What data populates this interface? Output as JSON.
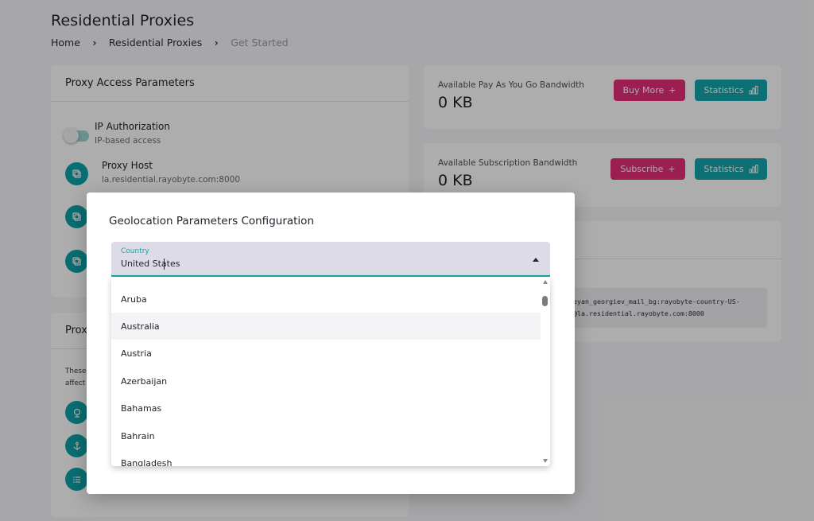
{
  "page": {
    "title": "Residential Proxies",
    "breadcrumb": [
      "Home",
      "Residential Proxies",
      "Get Started"
    ]
  },
  "access_card": {
    "title": "Proxy Access Parameters",
    "ip_auth": {
      "title": "IP Authorization",
      "subtitle": "IP-based access"
    },
    "proxy_host": {
      "title": "Proxy Host",
      "value": "la.residential.rayobyte.com:8000"
    }
  },
  "second_card": {
    "title_partial": "Prox",
    "text_line1": "These",
    "text_line2": "affect"
  },
  "payg_card": {
    "label": "Available Pay As You Go Bandwidth",
    "value": "0 KB",
    "buy_more": "Buy More",
    "statistics": "Statistics"
  },
  "subscription_card": {
    "label": "Available Subscription Bandwidth",
    "value": "0 KB",
    "subscribe": "Subscribe",
    "statistics": "Statistics"
  },
  "code": {
    "line1": "eyan_georgiev_mail_bg:rayobyte-country-US-",
    "line2": "@la.residential.rayobyte.com:8000"
  },
  "modal": {
    "title": "Geolocation Parameters Configuration",
    "select": {
      "label": "Country",
      "value": "United States"
    },
    "options": [
      "Aruba",
      "Australia",
      "Austria",
      "Azerbaijan",
      "Bahamas",
      "Bahrain",
      "Bangladesh"
    ],
    "hovered_option": "Australia"
  },
  "colors": {
    "accent_teal": "#14a6ab",
    "accent_pink": "#e52e77"
  }
}
